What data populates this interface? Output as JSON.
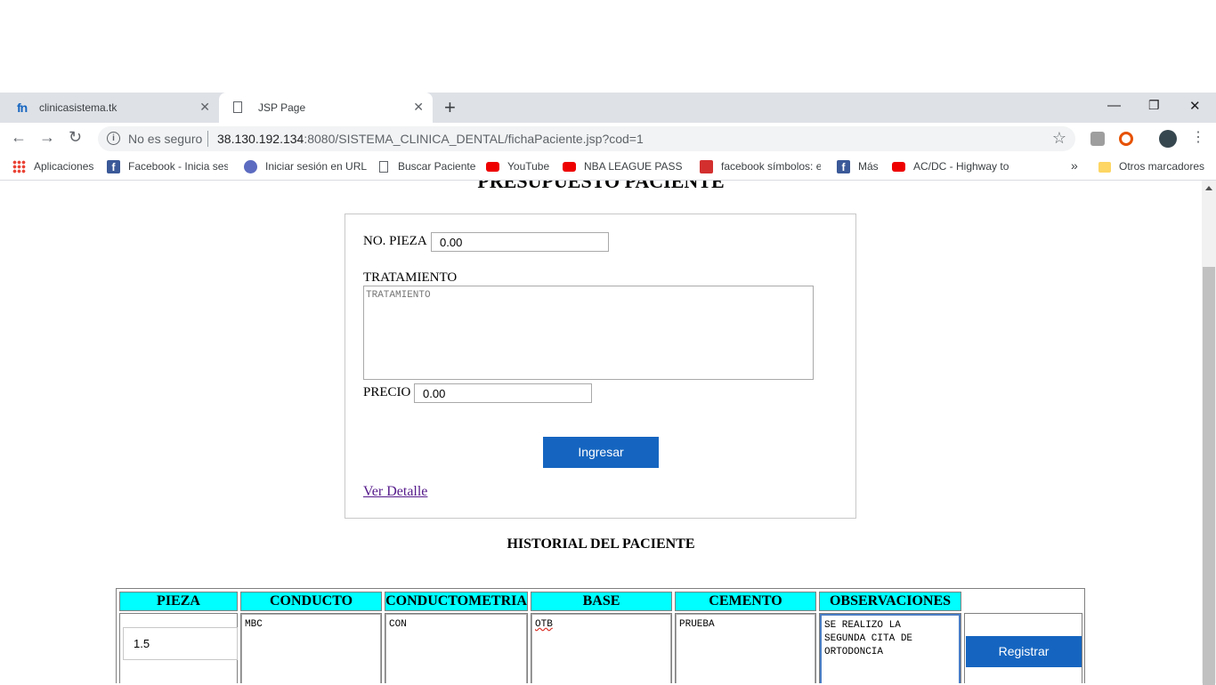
{
  "browser": {
    "tabs": [
      {
        "title": "clinicasistema.tk",
        "active": false
      },
      {
        "title": "JSP Page",
        "active": true
      }
    ],
    "security_label": "No es seguro",
    "url_host": "38.130.192.134",
    "url_rest": ":8080/SISTEMA_CLINICA_DENTAL/fichaPaciente.jsp?cod=1",
    "bookmarks": [
      "Aplicaciones",
      "Facebook - Inicia sesi",
      "Iniciar sesión en URL",
      "Buscar Paciente",
      "YouTube",
      "NBA LEAGUE PASS H",
      "facebook símbolos: e",
      "Más",
      "AC/DC - Highway to",
      "»",
      "Otros marcadores"
    ]
  },
  "page": {
    "title": "PRESUPUESTO PACIENTE",
    "form": {
      "pieza_label": "NO. PIEZA",
      "pieza_value": "0.00",
      "tratamiento_label": "TRATAMIENTO",
      "tratamiento_placeholder": "TRATAMIENTO",
      "precio_label": "PRECIO",
      "precio_value": "0.00",
      "submit_label": "Ingresar",
      "detail_link": "Ver Detalle"
    },
    "history": {
      "title": "HISTORIAL DEL PACIENTE",
      "columns": [
        "PIEZA",
        "CONDUCTO",
        "CONDUCTOMETRIA",
        "BASE",
        "CEMENTO",
        "OBSERVACIONES"
      ],
      "row": {
        "pieza": "1.5",
        "conducto": "MBC",
        "conductometria": "CON",
        "base": "OTB",
        "cemento": "PRUEBA",
        "observaciones": "SE REALIZO LA SEGUNDA CITA DE ORTODONCIA"
      },
      "register_label": "Registrar"
    }
  },
  "colors": {
    "header_cyan": "#00ffff",
    "button_blue": "#1565c0",
    "link_visited": "#551a8b"
  }
}
